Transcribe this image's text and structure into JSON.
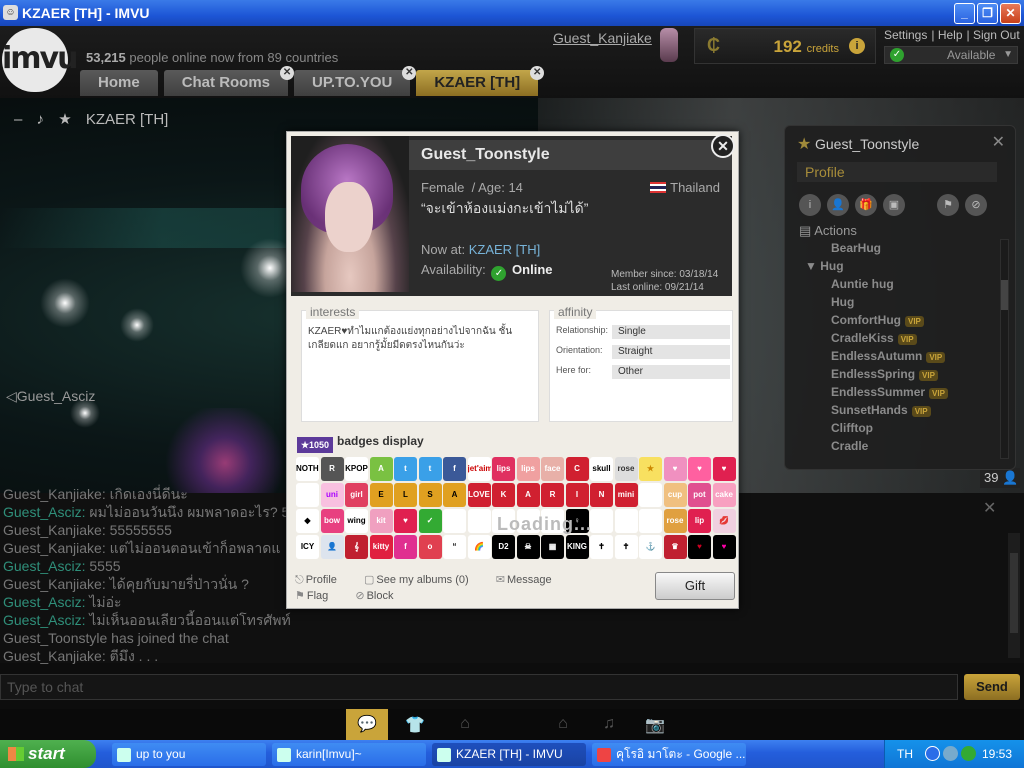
{
  "window": {
    "title": "KZAER [TH] - IMVU"
  },
  "header": {
    "logo": "imvu",
    "online_count": "53,215",
    "online_text": "people online now from 89 countries",
    "username": "Guest_Kanjiake",
    "credits": "192",
    "credits_label": "credits",
    "links": [
      "Settings",
      "Help",
      "Sign Out"
    ],
    "status": "Available",
    "tabs": [
      {
        "label": "Home",
        "closable": false
      },
      {
        "label": "Chat Rooms",
        "closable": true
      },
      {
        "label": "UP.TO.YOU",
        "closable": true
      },
      {
        "label": "KZAER [TH]",
        "closable": true
      }
    ]
  },
  "scene": {
    "room_title": "KZAER [TH]",
    "avatar_label": "Guest_Asciz",
    "people_count": "39"
  },
  "side_profile": {
    "name": "Guest_Toonstyle",
    "profile_label": "Profile",
    "actions_label": "Actions",
    "items": [
      {
        "label": "BearHug",
        "type": "sub",
        "vip": false
      },
      {
        "label": "Hug",
        "type": "grp",
        "vip": false
      },
      {
        "label": "Auntie hug",
        "type": "sub",
        "vip": false
      },
      {
        "label": "Hug",
        "type": "sub",
        "vip": false
      },
      {
        "label": "ComfortHug",
        "type": "sub",
        "vip": true
      },
      {
        "label": "CradleKiss",
        "type": "sub",
        "vip": true
      },
      {
        "label": "EndlessAutumn",
        "type": "sub",
        "vip": true
      },
      {
        "label": "EndlessSpring",
        "type": "sub",
        "vip": true
      },
      {
        "label": "EndlessSummer",
        "type": "sub",
        "vip": true
      },
      {
        "label": "SunsetHands",
        "type": "sub",
        "vip": true
      },
      {
        "label": "Clifftop",
        "type": "sub",
        "vip": false
      },
      {
        "label": "Cradle",
        "type": "sub",
        "vip": false
      }
    ]
  },
  "chat": {
    "lines": [
      {
        "nick": "Guest_Kanjiake",
        "msg": "เกิดเองนี่ดีนะ",
        "color": "nk"
      },
      {
        "nick": "Guest_Asciz",
        "msg": "ผมไม่ออนวันนึง ผมพลาดอะไร? 5",
        "color": "na"
      },
      {
        "nick": "Guest_Kanjiake",
        "msg": "55555555",
        "color": "nk"
      },
      {
        "nick": "Guest_Kanjiake",
        "msg": "แต่ไม่ออนตอนเข้าก็อพลาดแ",
        "color": "nk"
      },
      {
        "nick": "Guest_Asciz",
        "msg": "5555",
        "color": "na"
      },
      {
        "nick": "Guest_Kanjiake",
        "msg": "ได้คุยกับมายรี่ป่าวนั่น ?",
        "color": "nk"
      },
      {
        "nick": "Guest_Asciz",
        "msg": "ไม่อ่ะ",
        "color": "na"
      },
      {
        "nick": "Guest_Asciz",
        "msg": "ไม่เห็นออนเลียวนี้ออนแต่โทรศัพท์",
        "color": "na"
      },
      {
        "nick": "",
        "msg": "Guest_Toonstyle has joined the chat",
        "color": "nk"
      },
      {
        "nick": "Guest_Kanjiake",
        "msg": "ตีมึง . . .",
        "color": "nk"
      }
    ],
    "input_placeholder": "Type to chat",
    "send_label": "Send"
  },
  "dock": {
    "icons": [
      "chat-bubble-icon",
      "shirt-icon",
      "hanger-icon",
      "home-icon",
      "music-icon",
      "camera-icon"
    ]
  },
  "modal": {
    "name": "Guest_Toonstyle",
    "gender": "Female",
    "age_text": "/ Age: 14",
    "country": "Thailand",
    "tagline": "“จะเข้าห้องแม่งกะเข้าไม่ได้”",
    "now_at_label": "Now at:",
    "now_at_room": "KZAER [TH]",
    "availability_label": "Availability:",
    "availability_value": "Online",
    "member_since": "Member since: 03/18/14",
    "last_online": "Last online: 09/21/14",
    "interests_title": "interests",
    "interests_text": "KZAER♥ทำไมแกต้องแย่งทุกอย่างไปจากฉัน ชั้นเกลียดแก อยากรู้มั้ยมีดตรงไหนกันว่ะ",
    "affinity_title": "affinity",
    "affinity": [
      {
        "label": "Relationship:",
        "value": "Single"
      },
      {
        "label": "Orientation:",
        "value": "Straight"
      },
      {
        "label": "Here for:",
        "value": "Other"
      }
    ],
    "badge_count": "1050",
    "badges_title": "badges display",
    "loading_text": "Loading...",
    "links": [
      {
        "label": "Profile",
        "icon": "share-icon"
      },
      {
        "label": "See my albums (0)",
        "icon": "album-icon"
      },
      {
        "label": "Message",
        "icon": "envelope-icon"
      },
      {
        "label": "Flag",
        "icon": "flag-icon"
      },
      {
        "label": "Block",
        "icon": "block-icon"
      }
    ],
    "gift_label": "Gift",
    "badges": [
      {
        "t": "NOTHING LASTS FOREVER",
        "c": "#ffffff",
        "fg": "#000"
      },
      {
        "t": "R",
        "c": "#555",
        "fg": "#fff"
      },
      {
        "t": "KPOP",
        "c": "#fff",
        "fg": "#000"
      },
      {
        "t": "A",
        "c": "#7ac142",
        "fg": "#fff"
      },
      {
        "t": "t",
        "c": "#3aa0e8",
        "fg": "#fff"
      },
      {
        "t": "t",
        "c": "#3aa0e8",
        "fg": "#fff"
      },
      {
        "t": "f",
        "c": "#3b5998",
        "fg": "#fff"
      },
      {
        "t": "jet'aime",
        "c": "#fff",
        "fg": "#c00"
      },
      {
        "t": "lips",
        "c": "#e03060",
        "fg": "#fff"
      },
      {
        "t": "lips",
        "c": "#f0a0a0",
        "fg": "#fff"
      },
      {
        "t": "face",
        "c": "#e8b0a8",
        "fg": "#fff"
      },
      {
        "t": "C",
        "c": "#d02030",
        "fg": "#fff"
      },
      {
        "t": "skull",
        "c": "#fff",
        "fg": "#000"
      },
      {
        "t": "rose",
        "c": "#ddd",
        "fg": "#333"
      },
      {
        "t": "★",
        "c": "#f8e060",
        "fg": "#c80"
      },
      {
        "t": "♥",
        "c": "#f090c0",
        "fg": "#fff"
      },
      {
        "t": "♥",
        "c": "#ff60a0",
        "fg": "#fff"
      },
      {
        "t": "♥",
        "c": "#e02050",
        "fg": "#fff"
      },
      {
        "t": "",
        "c": "#fff",
        "fg": "#000"
      },
      {
        "t": "uni",
        "c": "#f8c0e0",
        "fg": "#a0f"
      },
      {
        "t": "girl",
        "c": "#e04060",
        "fg": "#fff"
      },
      {
        "t": "E",
        "c": "#e0a020",
        "fg": "#000"
      },
      {
        "t": "L",
        "c": "#e0a020",
        "fg": "#000"
      },
      {
        "t": "S",
        "c": "#e0a020",
        "fg": "#000"
      },
      {
        "t": "A",
        "c": "#e0a020",
        "fg": "#000"
      },
      {
        "t": "LOVE",
        "c": "#d02030",
        "fg": "#fff"
      },
      {
        "t": "K",
        "c": "#d02030",
        "fg": "#fff"
      },
      {
        "t": "A",
        "c": "#d02030",
        "fg": "#fff"
      },
      {
        "t": "R",
        "c": "#d02030",
        "fg": "#fff"
      },
      {
        "t": "I",
        "c": "#d02030",
        "fg": "#fff"
      },
      {
        "t": "N",
        "c": "#d02030",
        "fg": "#fff"
      },
      {
        "t": "mini",
        "c": "#d02030",
        "fg": "#fff"
      },
      {
        "t": "",
        "c": "#fff",
        "fg": "#000"
      },
      {
        "t": "cup",
        "c": "#f0c080",
        "fg": "#fff"
      },
      {
        "t": "pot",
        "c": "#e05090",
        "fg": "#fff"
      },
      {
        "t": "cake",
        "c": "#f8a0c0",
        "fg": "#fff"
      },
      {
        "t": "◆",
        "c": "#fff",
        "fg": "#000"
      },
      {
        "t": "bow",
        "c": "#e84080",
        "fg": "#fff"
      },
      {
        "t": "wing",
        "c": "#fff",
        "fg": "#000"
      },
      {
        "t": "kit",
        "c": "#f0a0c0",
        "fg": "#fff"
      },
      {
        "t": "♥",
        "c": "#e02050",
        "fg": "#fff"
      },
      {
        "t": "✓",
        "c": "#3a3",
        "fg": "#fff"
      },
      {
        "t": "",
        "c": "#fff",
        "fg": "#000"
      },
      {
        "t": "",
        "c": "#fff",
        "fg": "#000"
      },
      {
        "t": "",
        "c": "#fff",
        "fg": "#000"
      },
      {
        "t": "",
        "c": "#fff",
        "fg": "#000"
      },
      {
        "t": "",
        "c": "#fff",
        "fg": "#000"
      },
      {
        "t": "♀",
        "c": "#000",
        "fg": "#fff"
      },
      {
        "t": "",
        "c": "#fff",
        "fg": "#000"
      },
      {
        "t": "",
        "c": "#fff",
        "fg": "#000"
      },
      {
        "t": "",
        "c": "#fff",
        "fg": "#000"
      },
      {
        "t": "rose",
        "c": "#e0a040",
        "fg": "#fff"
      },
      {
        "t": "lip",
        "c": "#e02050",
        "fg": "#fff"
      },
      {
        "t": "💋",
        "c": "#f0d0e0",
        "fg": "#c00"
      },
      {
        "t": "ICY",
        "c": "#fff",
        "fg": "#000"
      },
      {
        "t": "👤",
        "c": "#dde4ee",
        "fg": "#99a"
      },
      {
        "t": "𝄞",
        "c": "#c02030",
        "fg": "#fff"
      },
      {
        "t": "kitty",
        "c": "#e02040",
        "fg": "#fff"
      },
      {
        "t": "f",
        "c": "#e03090",
        "fg": "#fff"
      },
      {
        "t": "o",
        "c": "#e04050",
        "fg": "#fff"
      },
      {
        "t": "“",
        "c": "#fff",
        "fg": "#000"
      },
      {
        "t": "🌈",
        "c": "#fff",
        "fg": "#e44"
      },
      {
        "t": "D2",
        "c": "#000",
        "fg": "#fff"
      },
      {
        "t": "☠",
        "c": "#000",
        "fg": "#fff"
      },
      {
        "t": "▦",
        "c": "#000",
        "fg": "#fff"
      },
      {
        "t": "KING",
        "c": "#000",
        "fg": "#fff"
      },
      {
        "t": "✝",
        "c": "#fff",
        "fg": "#000"
      },
      {
        "t": "✝",
        "c": "#fff",
        "fg": "#000"
      },
      {
        "t": "⚓",
        "c": "#fff",
        "fg": "#000"
      },
      {
        "t": "♛",
        "c": "#c02030",
        "fg": "#fff"
      },
      {
        "t": "♥",
        "c": "#000",
        "fg": "#c02"
      },
      {
        "t": "♥",
        "c": "#000",
        "fg": "#f0a"
      }
    ]
  }
}
